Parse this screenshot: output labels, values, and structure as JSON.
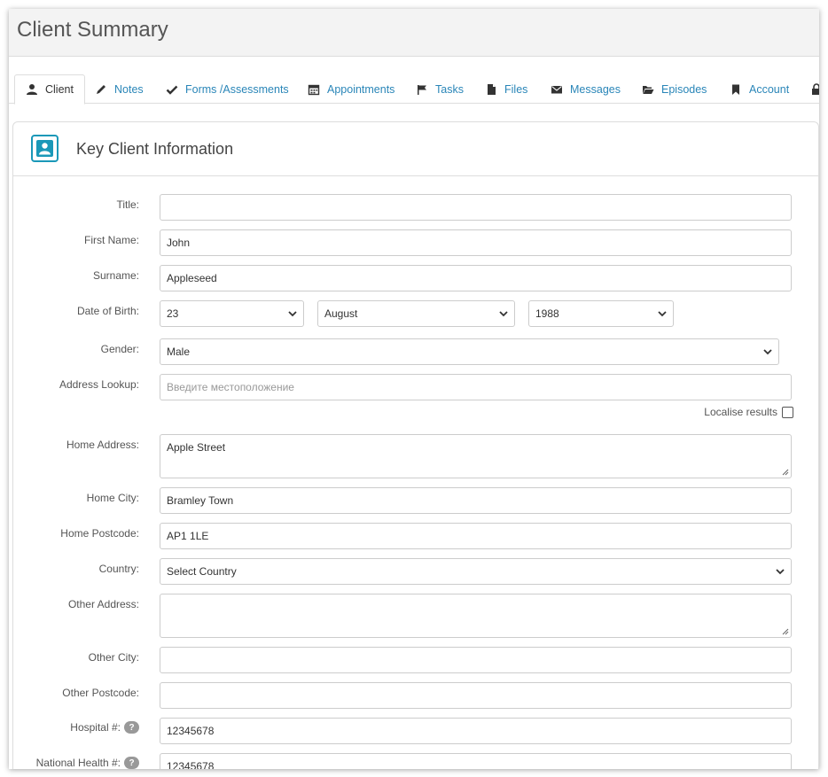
{
  "header": {
    "title": "Client Summary"
  },
  "tabs": [
    {
      "label": "Client",
      "icon": "user-icon"
    },
    {
      "label": "Notes",
      "icon": "pencil-icon"
    },
    {
      "label": "Forms /Assessments",
      "icon": "check-icon"
    },
    {
      "label": "Appointments",
      "icon": "calendar-icon"
    },
    {
      "label": "Tasks",
      "icon": "flag-icon"
    },
    {
      "label": "Files",
      "icon": "file-icon"
    },
    {
      "label": "Messages",
      "icon": "envelope-icon"
    },
    {
      "label": "Episodes",
      "icon": "folder-open-icon"
    },
    {
      "label": "Account",
      "icon": "bookmark-icon"
    }
  ],
  "panel": {
    "title": "Key Client Information"
  },
  "form": {
    "title": {
      "label": "Title:",
      "value": ""
    },
    "first_name": {
      "label": "First Name:",
      "value": "John"
    },
    "surname": {
      "label": "Surname:",
      "value": "Appleseed"
    },
    "dob": {
      "label": "Date of Birth:",
      "day": "23",
      "month": "August",
      "year": "1988"
    },
    "gender": {
      "label": "Gender:",
      "value": "Male"
    },
    "address_lookup": {
      "label": "Address Lookup:",
      "placeholder": "Введите местоположение"
    },
    "localise": {
      "label": "Localise results",
      "checked": false
    },
    "home_address": {
      "label": "Home Address:",
      "value": "Apple Street"
    },
    "home_city": {
      "label": "Home City:",
      "value": "Bramley Town"
    },
    "home_postcode": {
      "label": "Home Postcode:",
      "value": "AP1 1LE"
    },
    "country": {
      "label": "Country:",
      "value": "Select Country"
    },
    "other_address": {
      "label": "Other Address:",
      "value": ""
    },
    "other_city": {
      "label": "Other City:",
      "value": ""
    },
    "other_postcode": {
      "label": "Other Postcode:",
      "value": ""
    },
    "hospital": {
      "label": "Hospital #:",
      "value": "12345678",
      "help": "?"
    },
    "national_health": {
      "label": "National Health #:",
      "value": "12345678",
      "help": "?"
    }
  },
  "colors": {
    "accent": "#1a98b8",
    "link": "#2a86b8"
  }
}
